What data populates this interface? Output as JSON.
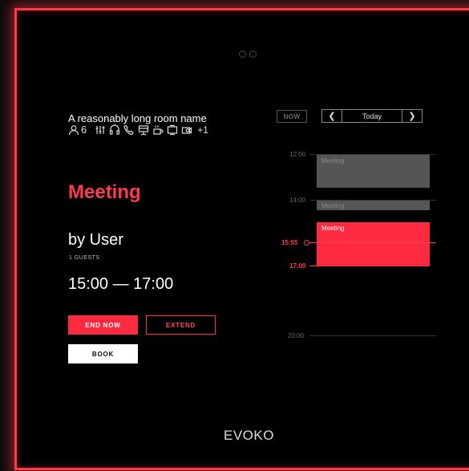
{
  "room": {
    "name": "A reasonably long room name",
    "capacity": "6",
    "amenities": [
      "equalizer-icon",
      "headset-icon",
      "phone-icon",
      "presentation-icon",
      "coffee-icon",
      "display-icon",
      "webcam-icon"
    ],
    "more_amenities": "+1"
  },
  "booking": {
    "status": "Meeting",
    "organizer": "by User",
    "guests": "1 GUESTS",
    "time_range": "15:00 — 17:00"
  },
  "actions": {
    "end_now": "END NOW",
    "extend": "EXTEND",
    "book": "BOOK"
  },
  "calendar": {
    "now_label": "NOW",
    "today_label": "Today",
    "time_labels": {
      "t1200": "12:00",
      "t1400": "14:00",
      "current": "15:55",
      "t1700": "17:00",
      "t2000": "20:00"
    },
    "events": [
      {
        "title": "Meeting"
      },
      {
        "title": "Meeting"
      },
      {
        "title": "Meeting"
      }
    ]
  },
  "brand": {
    "logo": "EVOKO"
  },
  "colors": {
    "accent": "#ff2a3f",
    "past_event": "#555555",
    "background": "#050505"
  }
}
